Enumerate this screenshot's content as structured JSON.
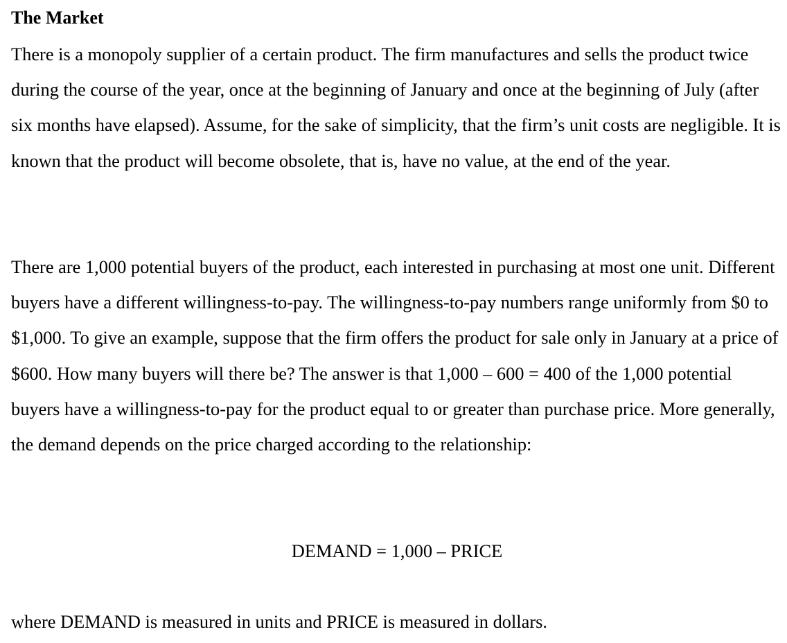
{
  "document": {
    "heading": "The Market",
    "paragraph1": "There is a monopoly supplier of a certain product. The firm manufactures and sells the product twice during the course of the year, once at the beginning of January and once at the beginning of July (after six months have elapsed). Assume, for the sake of simplicity, that the firm’s unit costs are negligible. It is known that the product will become obsolete, that is, have no value, at the end of the year.",
    "paragraph2": "There are 1,000 potential buyers of the product, each interested in purchasing at most one unit. Different buyers have a different willingness-to-pay. The willingness-to-pay numbers range uniformly from $0 to $1,000. To give an example, suppose that the firm offers the product for sale only in January at a price of $600. How many buyers will there be? The answer is that 1,000 – 600 = 400 of the 1,000 potential buyers have a willingness-to-pay for the product equal to or greater than purchase price. More generally, the demand depends on the price charged according to the relationship:",
    "formula": "DEMAND = 1,000 – PRICE",
    "paragraph3": "where DEMAND is measured in units and PRICE is measured in dollars."
  }
}
